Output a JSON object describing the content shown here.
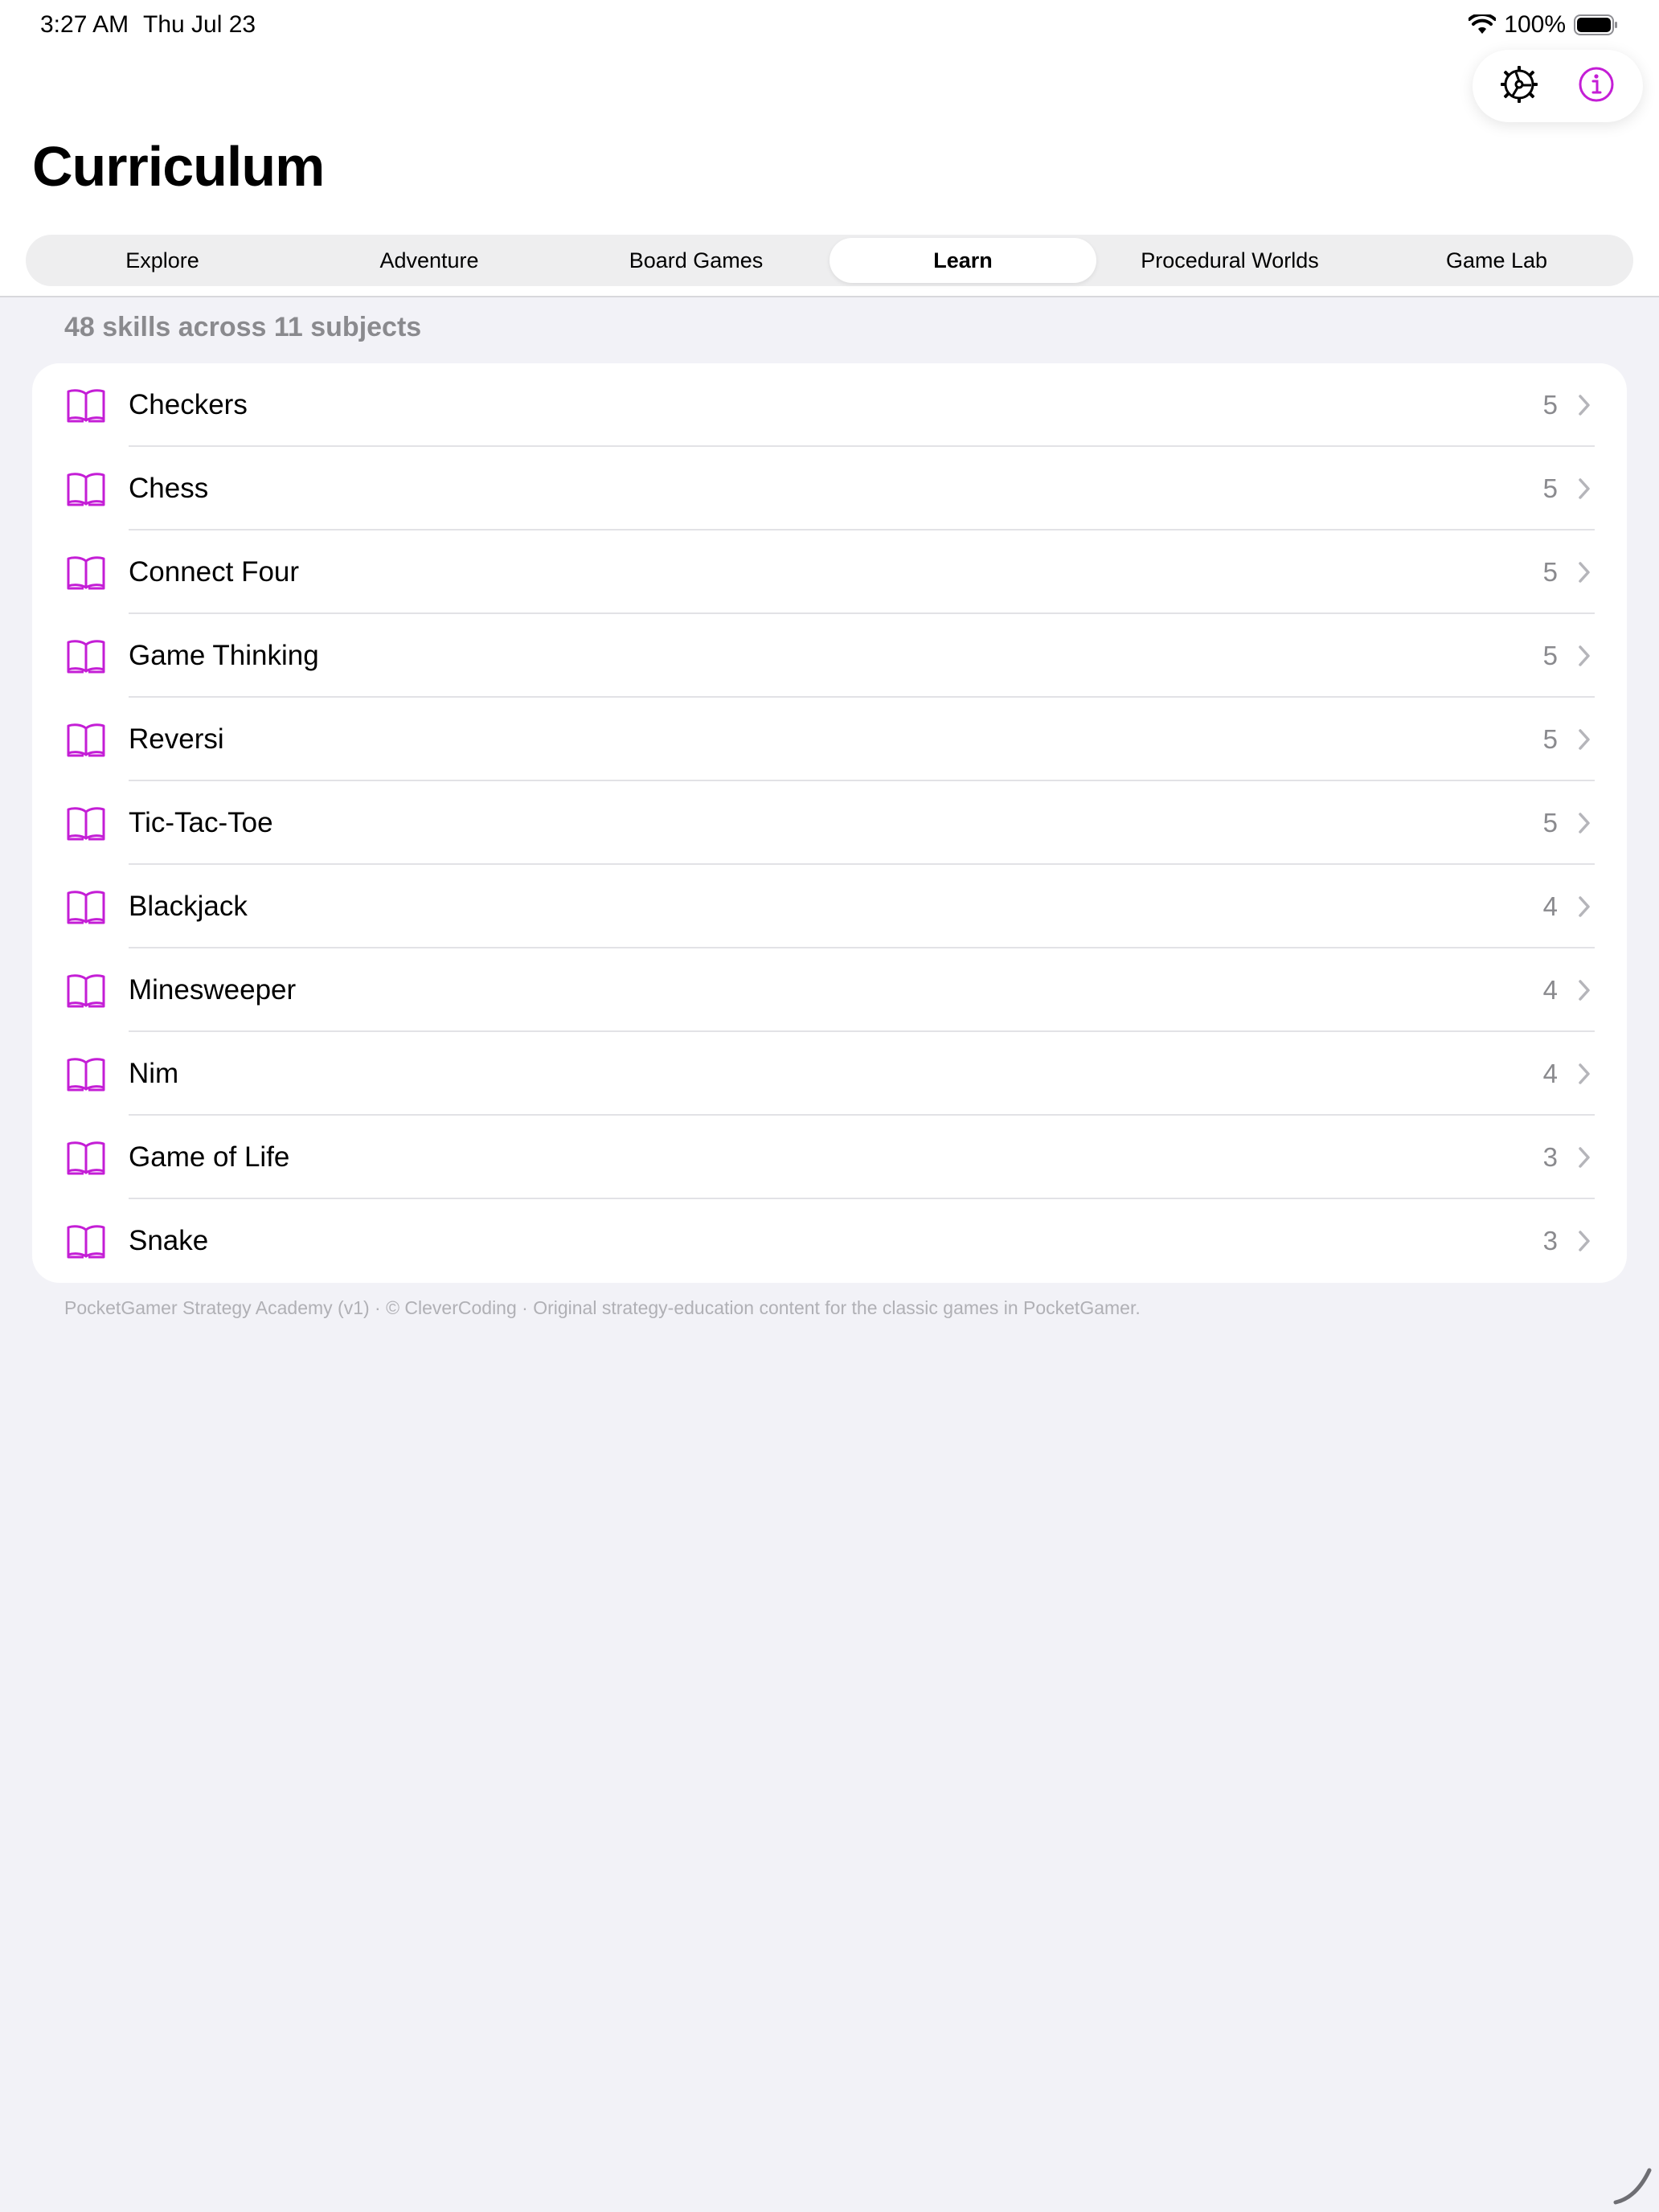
{
  "status_bar": {
    "time": "3:27 AM",
    "date": "Thu Jul 23",
    "battery_percent": "100%",
    "icons": [
      "wifi-icon",
      "battery-icon"
    ]
  },
  "toolbar": {
    "buttons": [
      {
        "icon": "settings-gear-icon"
      },
      {
        "icon": "info-icon"
      }
    ]
  },
  "header": {
    "title": "Curriculum"
  },
  "tabs": [
    {
      "label": "Explore",
      "active": false
    },
    {
      "label": "Adventure",
      "active": false
    },
    {
      "label": "Board Games",
      "active": false
    },
    {
      "label": "Learn",
      "active": true
    },
    {
      "label": "Procedural Worlds",
      "active": false
    },
    {
      "label": "Game Lab",
      "active": false
    }
  ],
  "summary": "48 skills across 11 subjects",
  "subjects": [
    {
      "label": "Checkers",
      "count": "5"
    },
    {
      "label": "Chess",
      "count": "5"
    },
    {
      "label": "Connect Four",
      "count": "5"
    },
    {
      "label": "Game Thinking",
      "count": "5"
    },
    {
      "label": "Reversi",
      "count": "5"
    },
    {
      "label": "Tic-Tac-Toe",
      "count": "5"
    },
    {
      "label": "Blackjack",
      "count": "4"
    },
    {
      "label": "Minesweeper",
      "count": "4"
    },
    {
      "label": "Nim",
      "count": "4"
    },
    {
      "label": "Game of Life",
      "count": "3"
    },
    {
      "label": "Snake",
      "count": "3"
    }
  ],
  "row_icon": "book-icon",
  "footer": "PocketGamer Strategy Academy (v1) · © CleverCoding · Original strategy-education content for the classic games in PocketGamer.",
  "colors": {
    "accent": "#c41ed6",
    "background": "#f2f2f7",
    "secondary_text": "#8a8a8e"
  }
}
